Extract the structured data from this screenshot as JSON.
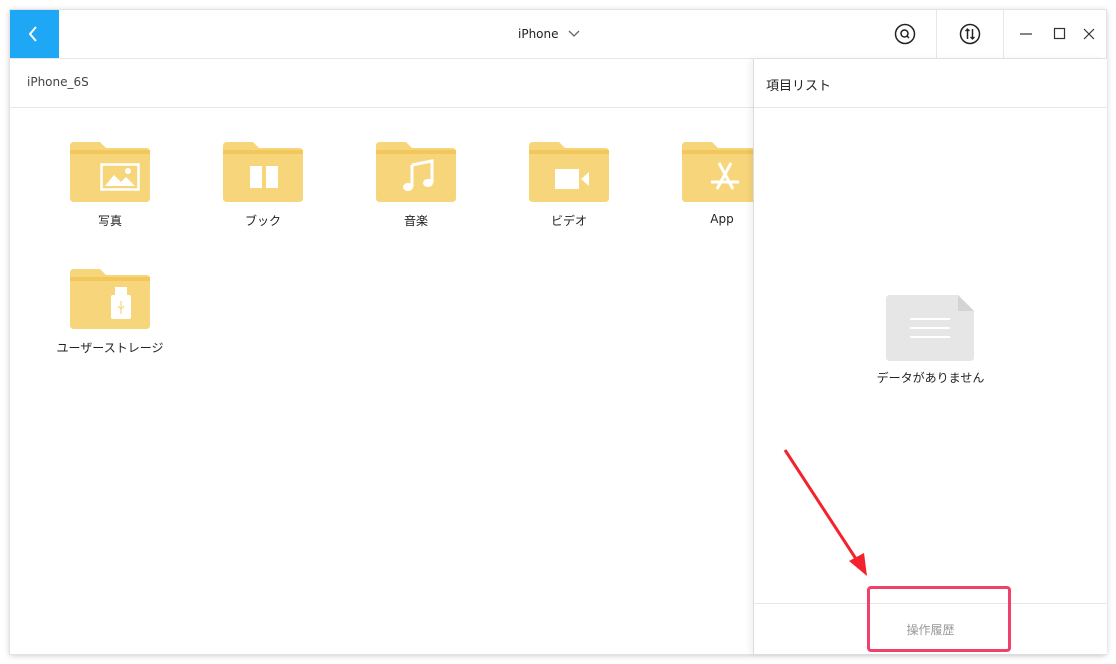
{
  "colors": {
    "accent": "#1ea7f5",
    "folder": "#f7d57b",
    "folder_tab": "#f2c75c",
    "annotation": "#f0416a"
  },
  "titlebar": {
    "device_name": "iPhone",
    "icons": [
      "back-icon",
      "chevron-down-icon",
      "search-icon",
      "transfer-icon",
      "minimize-icon",
      "maximize-icon",
      "close-icon"
    ]
  },
  "breadcrumb": "iPhone_6S",
  "folders": [
    {
      "label": "写真",
      "icon": "photo-icon"
    },
    {
      "label": "ブック",
      "icon": "book-icon"
    },
    {
      "label": "音楽",
      "icon": "music-icon"
    },
    {
      "label": "ビデオ",
      "icon": "video-icon"
    },
    {
      "label": "App",
      "icon": "app-store-icon"
    },
    {
      "label": "ユーザーストレージ",
      "icon": "usb-icon"
    }
  ],
  "panel": {
    "title": "項目リスト",
    "empty_text": "データがありません",
    "history_label": "操作履歴"
  }
}
